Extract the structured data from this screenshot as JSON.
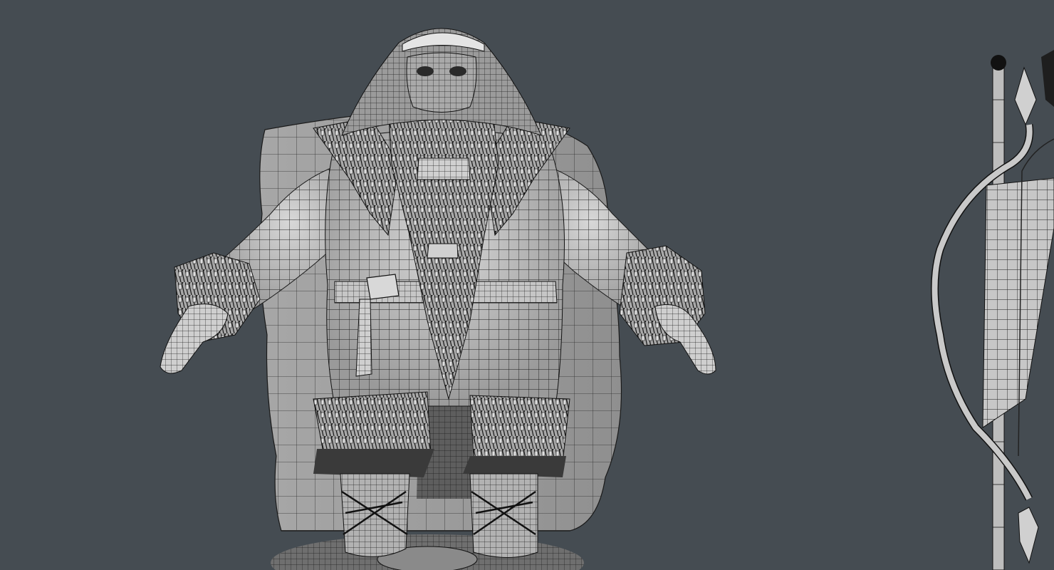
{
  "scene": {
    "background_color": "#454c52",
    "mesh_fill": "#b9b9b9",
    "mesh_fill_light": "#d6d6d6",
    "mesh_fill_dark": "#8e8e8e",
    "wire_color": "#1a1a1a",
    "render_mode": "wireframe-on-shaded",
    "objects": [
      {
        "name": "hooded-fur-coat-character"
      },
      {
        "name": "cape-backplate"
      },
      {
        "name": "circular-base"
      },
      {
        "name": "bow-and-quiver-prop"
      }
    ]
  }
}
